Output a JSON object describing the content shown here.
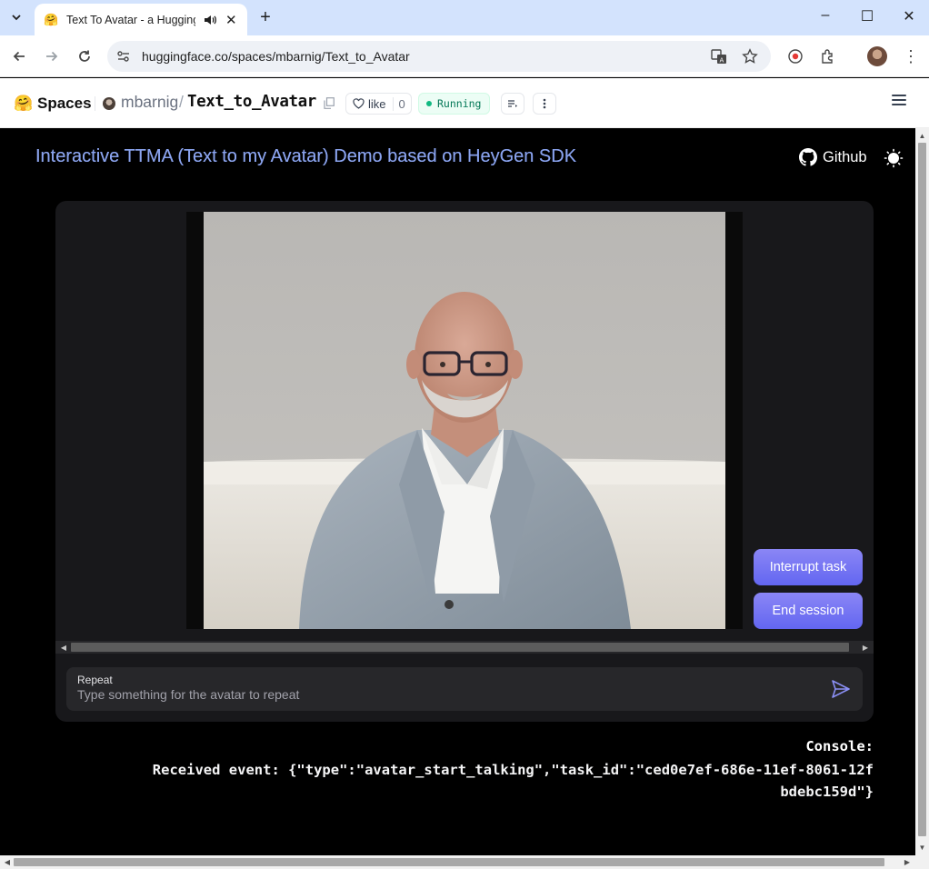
{
  "browser": {
    "tab_title": "Text To Avatar - a Hugging Face Space",
    "url": "huggingface.co/spaces/mbarnig/Text_to_Avatar",
    "window_controls": {
      "minimize": "–",
      "maximize": "☐",
      "close": "✕"
    }
  },
  "hf_header": {
    "spaces_label": "Spaces",
    "user": "mbarnig",
    "separator": "/",
    "repo": "Text_to_Avatar",
    "like_label": "like",
    "like_count": "0",
    "status": "Running"
  },
  "app": {
    "title": "Interactive TTMA (Text to my Avatar) Demo based on HeyGen SDK",
    "github_label": "Github",
    "interrupt_label": "Interrupt task",
    "end_session_label": "End session",
    "input_label": "Repeat",
    "input_placeholder": "Type something for the avatar to repeat",
    "input_value": "",
    "console_title": "Console:",
    "console_text": "Received event: {\"type\":\"avatar_start_talking\",\"task_id\":\"ced0e7ef-686e-11ef-8061-12fbdebc159d\"}"
  },
  "colors": {
    "accent": "#6366f1",
    "title_blue": "#8aa3ee",
    "running_green": "#10b981",
    "tabbar": "#d3e3fd"
  },
  "icons": [
    "chevron-down-icon",
    "speaker-icon",
    "close-icon",
    "plus-icon",
    "back-icon",
    "forward-icon",
    "reload-icon",
    "site-info-icon",
    "translate-icon",
    "star-icon",
    "record-icon",
    "extensions-icon",
    "more-icon",
    "heart-icon",
    "copy-icon",
    "github-icon",
    "sun-icon",
    "send-icon",
    "hamburger-icon"
  ]
}
